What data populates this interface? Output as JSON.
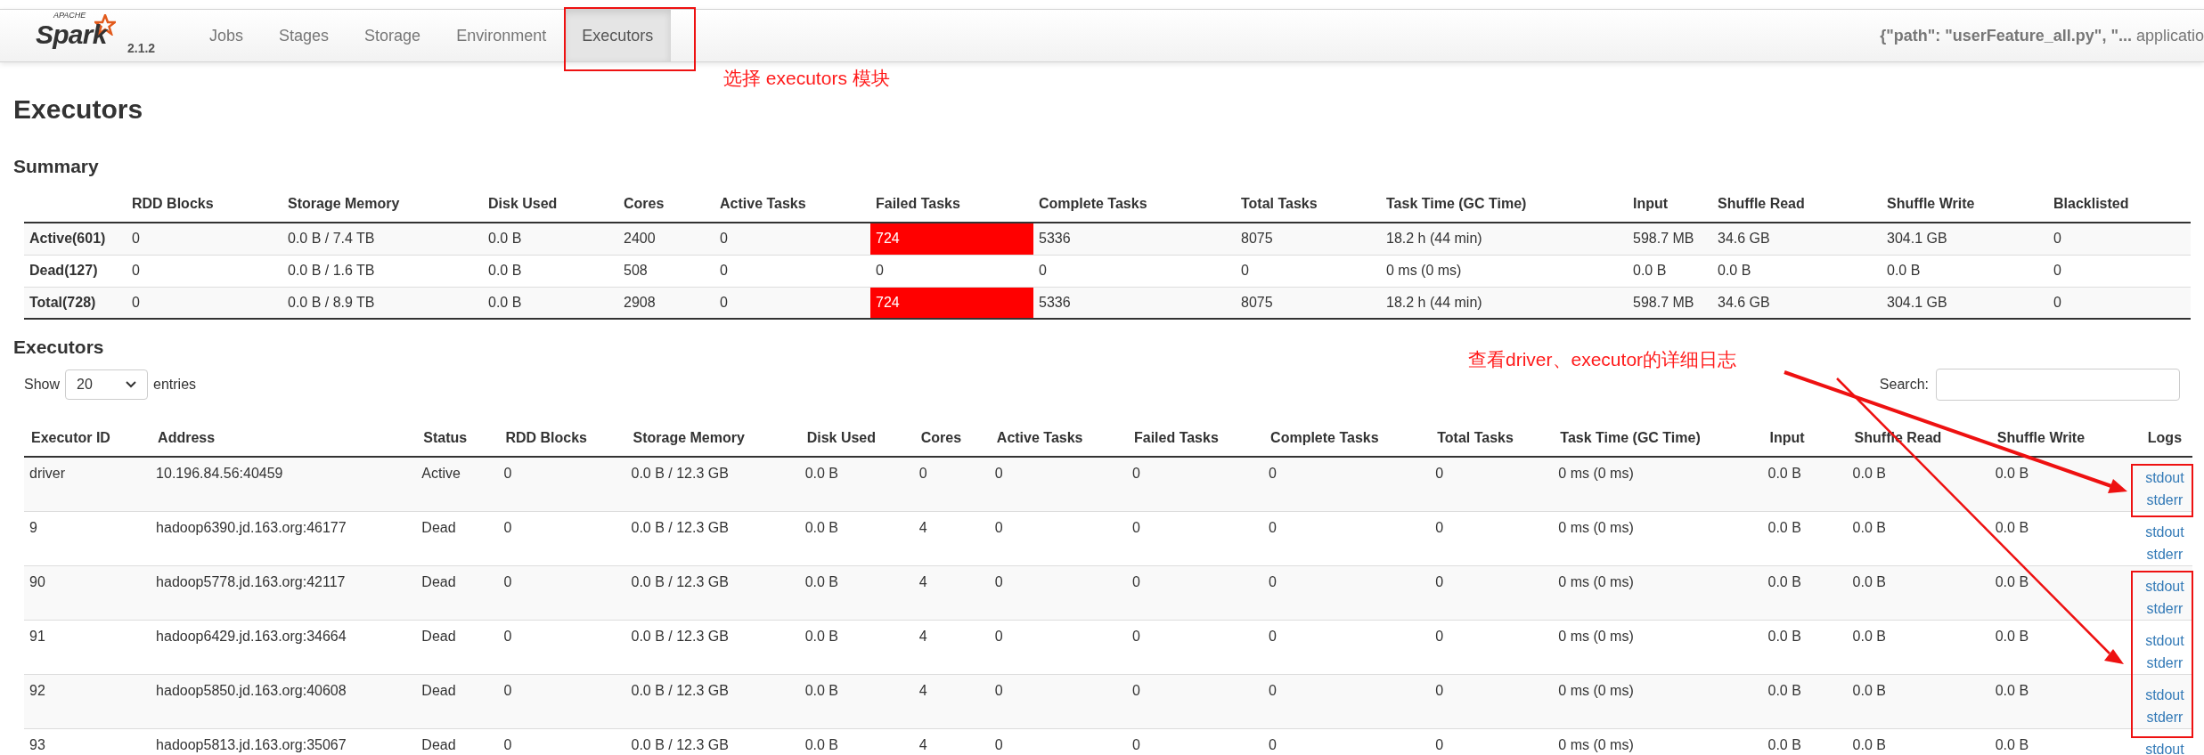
{
  "navbar": {
    "logo": {
      "apache": "APACHE",
      "brand": "Spark",
      "version": "2.1.2"
    },
    "tabs": [
      {
        "label": "Jobs",
        "selected": false
      },
      {
        "label": "Stages",
        "selected": false
      },
      {
        "label": "Storage",
        "selected": false
      },
      {
        "label": "Environment",
        "selected": false
      },
      {
        "label": "Executors",
        "selected": true
      }
    ],
    "app_title": "**{\"path\": \"userFeature_all.py\", \"...** applicatio"
  },
  "page_title": "Executors",
  "summary": {
    "title": "Summary",
    "columns": [
      "RDD Blocks",
      "Storage Memory",
      "Disk Used",
      "Cores",
      "Active Tasks",
      "Failed Tasks",
      "Complete Tasks",
      "Total Tasks",
      "Task Time (GC Time)",
      "Input",
      "Shuffle Read",
      "Shuffle Write",
      "Blacklisted"
    ],
    "rows": [
      {
        "label": "Active(601)",
        "failed_alert": true,
        "cells": [
          "0",
          "0.0 B / 7.4 TB",
          "0.0 B",
          "2400",
          "0",
          "724",
          "5336",
          "8075",
          "18.2 h (44 min)",
          "598.7 MB",
          "34.6 GB",
          "304.1 GB",
          "0"
        ]
      },
      {
        "label": "Dead(127)",
        "failed_alert": false,
        "cells": [
          "0",
          "0.0 B / 1.6 TB",
          "0.0 B",
          "508",
          "0",
          "0",
          "0",
          "0",
          "0 ms (0 ms)",
          "0.0 B",
          "0.0 B",
          "0.0 B",
          "0"
        ]
      },
      {
        "label": "Total(728)",
        "failed_alert": true,
        "cells": [
          "0",
          "0.0 B / 8.9 TB",
          "0.0 B",
          "2908",
          "0",
          "724",
          "5336",
          "8075",
          "18.2 h (44 min)",
          "598.7 MB",
          "34.6 GB",
          "304.1 GB",
          "0"
        ]
      }
    ]
  },
  "executors": {
    "title": "Executors",
    "show_label": "Show",
    "page_size": "20",
    "entries_label": "entries",
    "search_label": "Search:",
    "columns": [
      "Executor ID",
      "Address",
      "Status",
      "RDD Blocks",
      "Storage Memory",
      "Disk Used",
      "Cores",
      "Active Tasks",
      "Failed Tasks",
      "Complete Tasks",
      "Total Tasks",
      "Task Time (GC Time)",
      "Input",
      "Shuffle Read",
      "Shuffle Write",
      "Logs"
    ],
    "rows": [
      {
        "cells": [
          "driver",
          "10.196.84.56:40459",
          "Active",
          "0",
          "0.0 B / 12.3 GB",
          "0.0 B",
          "0",
          "0",
          "0",
          "0",
          "0",
          "0 ms (0 ms)",
          "0.0 B",
          "0.0 B",
          "0.0 B"
        ],
        "logs": [
          "stdout",
          "stderr"
        ]
      },
      {
        "cells": [
          "9",
          "hadoop6390.jd.163.org:46177",
          "Dead",
          "0",
          "0.0 B / 12.3 GB",
          "0.0 B",
          "4",
          "0",
          "0",
          "0",
          "0",
          "0 ms (0 ms)",
          "0.0 B",
          "0.0 B",
          "0.0 B"
        ],
        "logs": [
          "stdout",
          "stderr"
        ]
      },
      {
        "cells": [
          "90",
          "hadoop5778.jd.163.org:42117",
          "Dead",
          "0",
          "0.0 B / 12.3 GB",
          "0.0 B",
          "4",
          "0",
          "0",
          "0",
          "0",
          "0 ms (0 ms)",
          "0.0 B",
          "0.0 B",
          "0.0 B"
        ],
        "logs": [
          "stdout",
          "stderr"
        ]
      },
      {
        "cells": [
          "91",
          "hadoop6429.jd.163.org:34664",
          "Dead",
          "0",
          "0.0 B / 12.3 GB",
          "0.0 B",
          "4",
          "0",
          "0",
          "0",
          "0",
          "0 ms (0 ms)",
          "0.0 B",
          "0.0 B",
          "0.0 B"
        ],
        "logs": [
          "stdout",
          "stderr"
        ]
      },
      {
        "cells": [
          "92",
          "hadoop5850.jd.163.org:40608",
          "Dead",
          "0",
          "0.0 B / 12.3 GB",
          "0.0 B",
          "4",
          "0",
          "0",
          "0",
          "0",
          "0 ms (0 ms)",
          "0.0 B",
          "0.0 B",
          "0.0 B"
        ],
        "logs": [
          "stdout",
          "stderr"
        ]
      },
      {
        "cells": [
          "93",
          "hadoop5813.jd.163.org:35067",
          "Dead",
          "0",
          "0.0 B / 12.3 GB",
          "0.0 B",
          "4",
          "0",
          "0",
          "0",
          "0",
          "0 ms (0 ms)",
          "0.0 B",
          "0.0 B",
          "0.0 B"
        ],
        "logs": [
          "stdout"
        ]
      }
    ]
  },
  "annotations": [
    {
      "text": "选择 executors 模块"
    },
    {
      "text": "查看driver、executor的详细日志"
    }
  ]
}
